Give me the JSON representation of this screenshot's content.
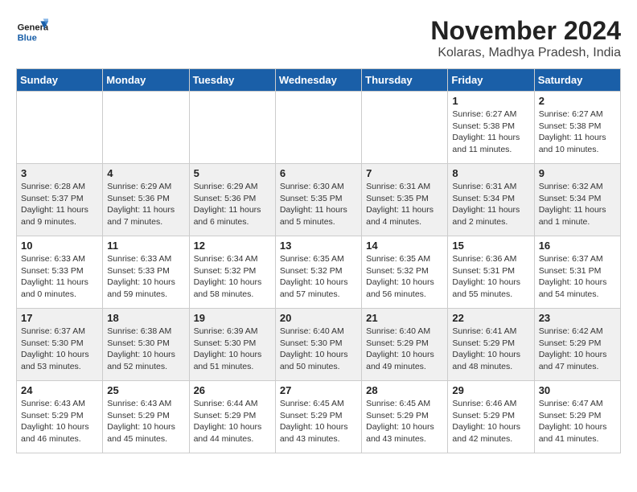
{
  "logo": {
    "line1": "General",
    "line2": "Blue"
  },
  "title": "November 2024",
  "location": "Kolaras, Madhya Pradesh, India",
  "days_of_week": [
    "Sunday",
    "Monday",
    "Tuesday",
    "Wednesday",
    "Thursday",
    "Friday",
    "Saturday"
  ],
  "weeks": [
    [
      {
        "day": "",
        "info": ""
      },
      {
        "day": "",
        "info": ""
      },
      {
        "day": "",
        "info": ""
      },
      {
        "day": "",
        "info": ""
      },
      {
        "day": "",
        "info": ""
      },
      {
        "day": "1",
        "info": "Sunrise: 6:27 AM\nSunset: 5:38 PM\nDaylight: 11 hours and 11 minutes."
      },
      {
        "day": "2",
        "info": "Sunrise: 6:27 AM\nSunset: 5:38 PM\nDaylight: 11 hours and 10 minutes."
      }
    ],
    [
      {
        "day": "3",
        "info": "Sunrise: 6:28 AM\nSunset: 5:37 PM\nDaylight: 11 hours and 9 minutes."
      },
      {
        "day": "4",
        "info": "Sunrise: 6:29 AM\nSunset: 5:36 PM\nDaylight: 11 hours and 7 minutes."
      },
      {
        "day": "5",
        "info": "Sunrise: 6:29 AM\nSunset: 5:36 PM\nDaylight: 11 hours and 6 minutes."
      },
      {
        "day": "6",
        "info": "Sunrise: 6:30 AM\nSunset: 5:35 PM\nDaylight: 11 hours and 5 minutes."
      },
      {
        "day": "7",
        "info": "Sunrise: 6:31 AM\nSunset: 5:35 PM\nDaylight: 11 hours and 4 minutes."
      },
      {
        "day": "8",
        "info": "Sunrise: 6:31 AM\nSunset: 5:34 PM\nDaylight: 11 hours and 2 minutes."
      },
      {
        "day": "9",
        "info": "Sunrise: 6:32 AM\nSunset: 5:34 PM\nDaylight: 11 hours and 1 minute."
      }
    ],
    [
      {
        "day": "10",
        "info": "Sunrise: 6:33 AM\nSunset: 5:33 PM\nDaylight: 11 hours and 0 minutes."
      },
      {
        "day": "11",
        "info": "Sunrise: 6:33 AM\nSunset: 5:33 PM\nDaylight: 10 hours and 59 minutes."
      },
      {
        "day": "12",
        "info": "Sunrise: 6:34 AM\nSunset: 5:32 PM\nDaylight: 10 hours and 58 minutes."
      },
      {
        "day": "13",
        "info": "Sunrise: 6:35 AM\nSunset: 5:32 PM\nDaylight: 10 hours and 57 minutes."
      },
      {
        "day": "14",
        "info": "Sunrise: 6:35 AM\nSunset: 5:32 PM\nDaylight: 10 hours and 56 minutes."
      },
      {
        "day": "15",
        "info": "Sunrise: 6:36 AM\nSunset: 5:31 PM\nDaylight: 10 hours and 55 minutes."
      },
      {
        "day": "16",
        "info": "Sunrise: 6:37 AM\nSunset: 5:31 PM\nDaylight: 10 hours and 54 minutes."
      }
    ],
    [
      {
        "day": "17",
        "info": "Sunrise: 6:37 AM\nSunset: 5:30 PM\nDaylight: 10 hours and 53 minutes."
      },
      {
        "day": "18",
        "info": "Sunrise: 6:38 AM\nSunset: 5:30 PM\nDaylight: 10 hours and 52 minutes."
      },
      {
        "day": "19",
        "info": "Sunrise: 6:39 AM\nSunset: 5:30 PM\nDaylight: 10 hours and 51 minutes."
      },
      {
        "day": "20",
        "info": "Sunrise: 6:40 AM\nSunset: 5:30 PM\nDaylight: 10 hours and 50 minutes."
      },
      {
        "day": "21",
        "info": "Sunrise: 6:40 AM\nSunset: 5:29 PM\nDaylight: 10 hours and 49 minutes."
      },
      {
        "day": "22",
        "info": "Sunrise: 6:41 AM\nSunset: 5:29 PM\nDaylight: 10 hours and 48 minutes."
      },
      {
        "day": "23",
        "info": "Sunrise: 6:42 AM\nSunset: 5:29 PM\nDaylight: 10 hours and 47 minutes."
      }
    ],
    [
      {
        "day": "24",
        "info": "Sunrise: 6:43 AM\nSunset: 5:29 PM\nDaylight: 10 hours and 46 minutes."
      },
      {
        "day": "25",
        "info": "Sunrise: 6:43 AM\nSunset: 5:29 PM\nDaylight: 10 hours and 45 minutes."
      },
      {
        "day": "26",
        "info": "Sunrise: 6:44 AM\nSunset: 5:29 PM\nDaylight: 10 hours and 44 minutes."
      },
      {
        "day": "27",
        "info": "Sunrise: 6:45 AM\nSunset: 5:29 PM\nDaylight: 10 hours and 43 minutes."
      },
      {
        "day": "28",
        "info": "Sunrise: 6:45 AM\nSunset: 5:29 PM\nDaylight: 10 hours and 43 minutes."
      },
      {
        "day": "29",
        "info": "Sunrise: 6:46 AM\nSunset: 5:29 PM\nDaylight: 10 hours and 42 minutes."
      },
      {
        "day": "30",
        "info": "Sunrise: 6:47 AM\nSunset: 5:29 PM\nDaylight: 10 hours and 41 minutes."
      }
    ]
  ]
}
